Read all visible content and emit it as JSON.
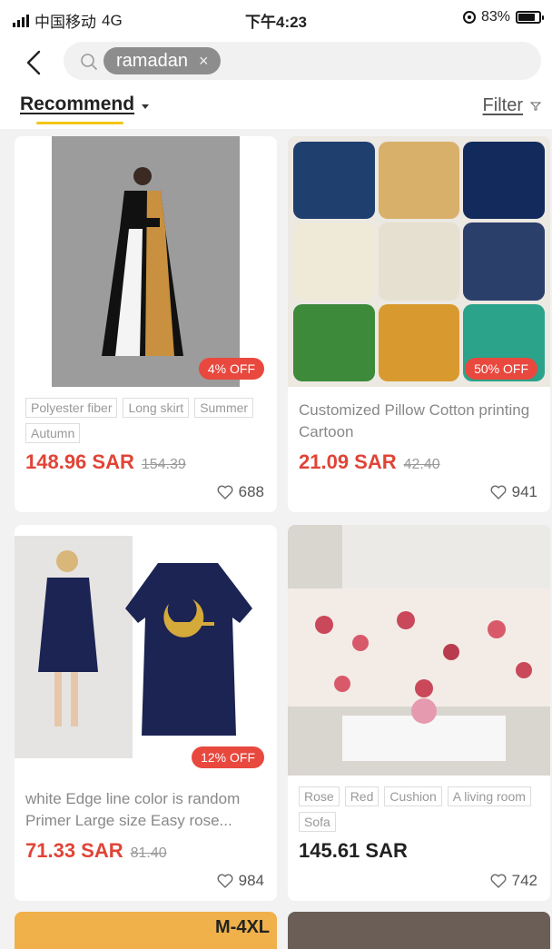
{
  "status": {
    "carrier": "中国移动",
    "network": "4G",
    "time": "下午4:23",
    "battery": "83%",
    "battery_level": 0.83
  },
  "search": {
    "query_chip": "ramadan",
    "clear_glyph": "×"
  },
  "sort": {
    "recommend_label": "Recommend",
    "filter_label": "Filter"
  },
  "products": [
    {
      "discount": "4% OFF",
      "tags": [
        "Polyester fiber",
        "Long skirt",
        "Summer",
        "Autumn"
      ],
      "price": "148.96 SAR",
      "old_price": "154.39",
      "likes": "688"
    },
    {
      "discount": "50% OFF",
      "title": "Customized Pillow Cotton printing Cartoon",
      "price": "21.09 SAR",
      "old_price": "42.40",
      "likes": "941"
    },
    {
      "discount": "12% OFF",
      "title": "white Edge line color is random Primer Large size Easy rose...",
      "price": "71.33 SAR",
      "old_price": "81.40",
      "likes": "984"
    },
    {
      "tags": [
        "Rose",
        "Red",
        "Cushion",
        "A living room",
        "Sofa"
      ],
      "price": "145.61 SAR",
      "likes": "742"
    }
  ],
  "partial": {
    "size_label": "M-4XL"
  },
  "colors": {
    "price_red": "#e04437",
    "badge_red": "#e8483e",
    "accent_yellow": "#f2c616"
  }
}
